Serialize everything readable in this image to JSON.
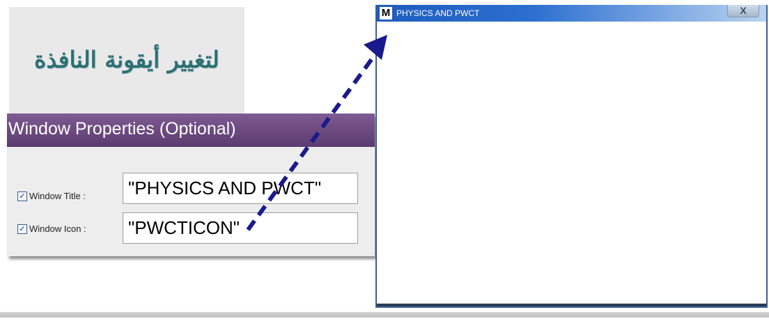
{
  "banner": {
    "text": "لتغيير أيقونة النافذة"
  },
  "panel": {
    "header": "Window Properties (Optional)",
    "rows": [
      {
        "checked": true,
        "label": "Window Title :",
        "value": "\"PHYSICS AND PWCT\""
      },
      {
        "checked": true,
        "label": "Window Icon :",
        "value": "\"PWCTICON\""
      }
    ]
  },
  "window": {
    "icon_letter": "M",
    "title": "PHYSICS AND PWCT",
    "close_glyph": "X"
  },
  "colors": {
    "header_purple": "#6a4a80",
    "banner_text": "#2c6f73",
    "arrow": "#1a1a8c",
    "titlebar_blue": "#1e5cbf"
  }
}
